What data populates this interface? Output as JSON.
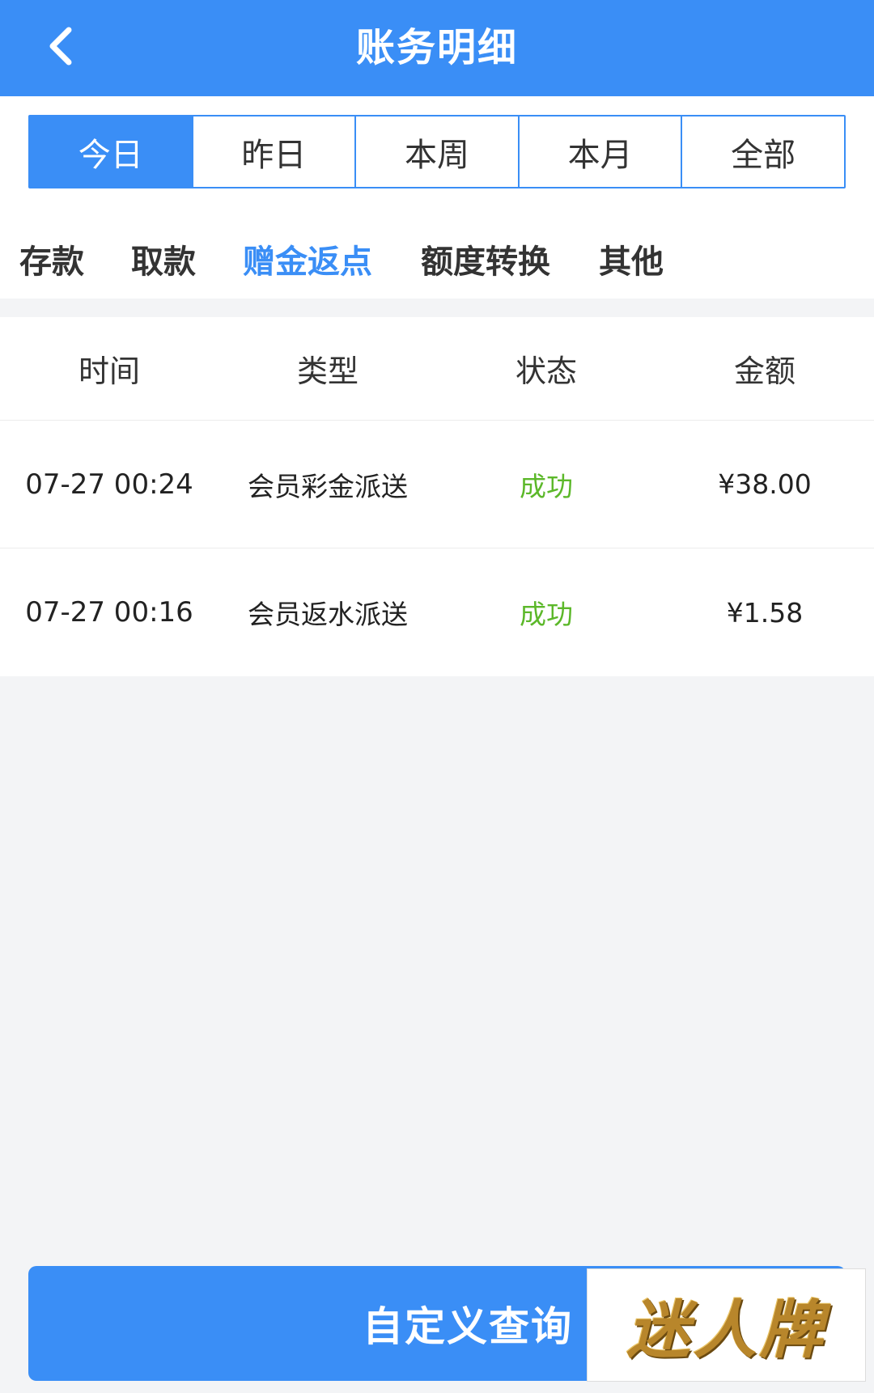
{
  "header": {
    "title": "账务明细",
    "back_icon": "chevron-left-icon"
  },
  "period_tabs": [
    {
      "label": "今日",
      "active": true
    },
    {
      "label": "昨日",
      "active": false
    },
    {
      "label": "本周",
      "active": false
    },
    {
      "label": "本月",
      "active": false
    },
    {
      "label": "全部",
      "active": false
    }
  ],
  "category_tabs": [
    {
      "label": "存款",
      "active": false
    },
    {
      "label": "取款",
      "active": false
    },
    {
      "label": "赠金返点",
      "active": true
    },
    {
      "label": "额度转换",
      "active": false
    },
    {
      "label": "其他",
      "active": false
    }
  ],
  "table": {
    "columns": [
      "时间",
      "类型",
      "状态",
      "金额"
    ],
    "rows": [
      {
        "time": "07-27 00:24",
        "type": "会员彩金派送",
        "status": "成功",
        "amount": "¥38.00"
      },
      {
        "time": "07-27 00:16",
        "type": "会员返水派送",
        "status": "成功",
        "amount": "¥1.58"
      }
    ]
  },
  "footer": {
    "button_label": "自定义查询",
    "watermark_text": "迷人牌"
  },
  "colors": {
    "primary": "#3a8ef6",
    "success": "#5cb82a",
    "background": "#f3f4f6"
  }
}
